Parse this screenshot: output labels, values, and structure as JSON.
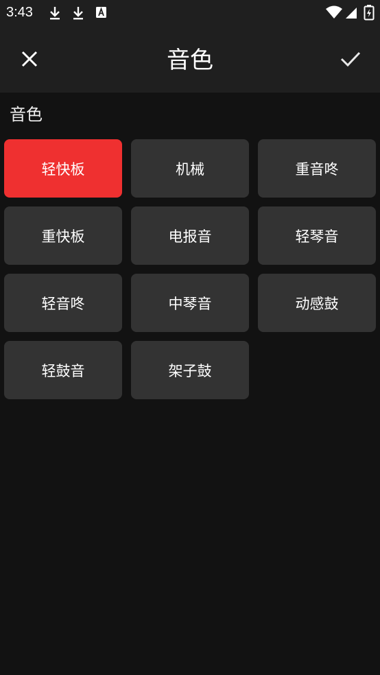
{
  "status_bar": {
    "time": "3:43",
    "icons": [
      "download-icon",
      "download-icon",
      "font-a-icon",
      "wifi-icon",
      "signal-icon",
      "battery-charging-icon"
    ]
  },
  "app_bar": {
    "title": "音色",
    "close_icon": "close-icon",
    "confirm_icon": "check-icon"
  },
  "section": {
    "label": "音色"
  },
  "tones": [
    {
      "label": "轻快板",
      "selected": true
    },
    {
      "label": "机械",
      "selected": false
    },
    {
      "label": "重音咚",
      "selected": false
    },
    {
      "label": "重快板",
      "selected": false
    },
    {
      "label": "电报音",
      "selected": false
    },
    {
      "label": "轻琴音",
      "selected": false
    },
    {
      "label": "轻音咚",
      "selected": false
    },
    {
      "label": "中琴音",
      "selected": false
    },
    {
      "label": "动感鼓",
      "selected": false
    },
    {
      "label": "轻鼓音",
      "selected": false
    },
    {
      "label": "架子鼓",
      "selected": false
    }
  ],
  "colors": {
    "accent": "#ef3030",
    "tile": "#333333",
    "background": "#121212",
    "bar": "#1f1f1f"
  }
}
